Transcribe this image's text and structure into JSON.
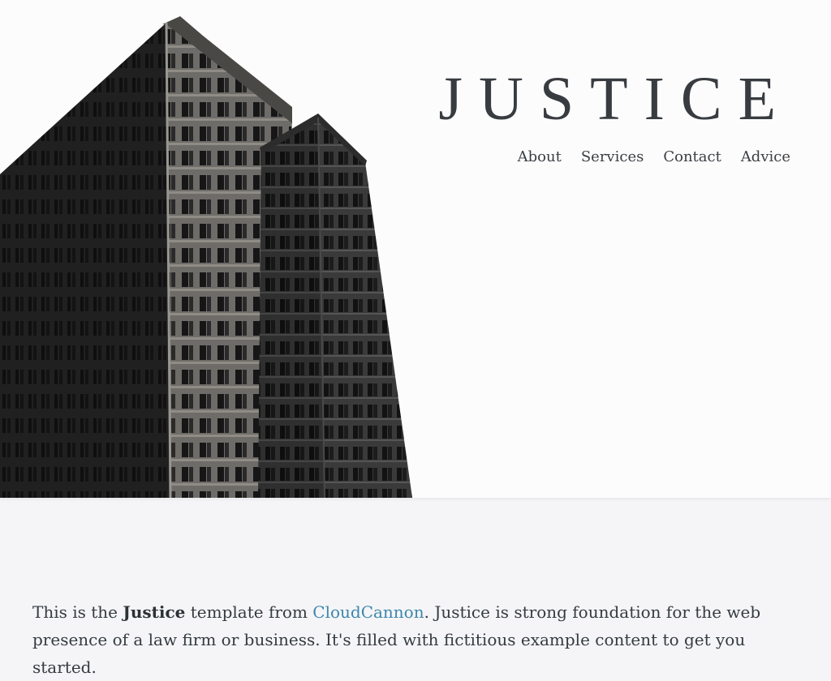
{
  "brand": {
    "title": "JUSTICE"
  },
  "nav": {
    "items": [
      {
        "label": "About"
      },
      {
        "label": "Services"
      },
      {
        "label": "Contact"
      },
      {
        "label": "Advice"
      }
    ]
  },
  "intro": {
    "prefix": "This is the ",
    "bold": "Justice",
    "middle": " template from ",
    "link": "CloudCannon",
    "suffix": ". Justice is strong foundation for the web presence of a law firm or business. It's filled with fictitious example content to get you started."
  },
  "colors": {
    "accent": "#3d87ad",
    "text": "#353b40",
    "hero_bg": "#fdfcfd",
    "page_bg": "#f5f5f7"
  }
}
